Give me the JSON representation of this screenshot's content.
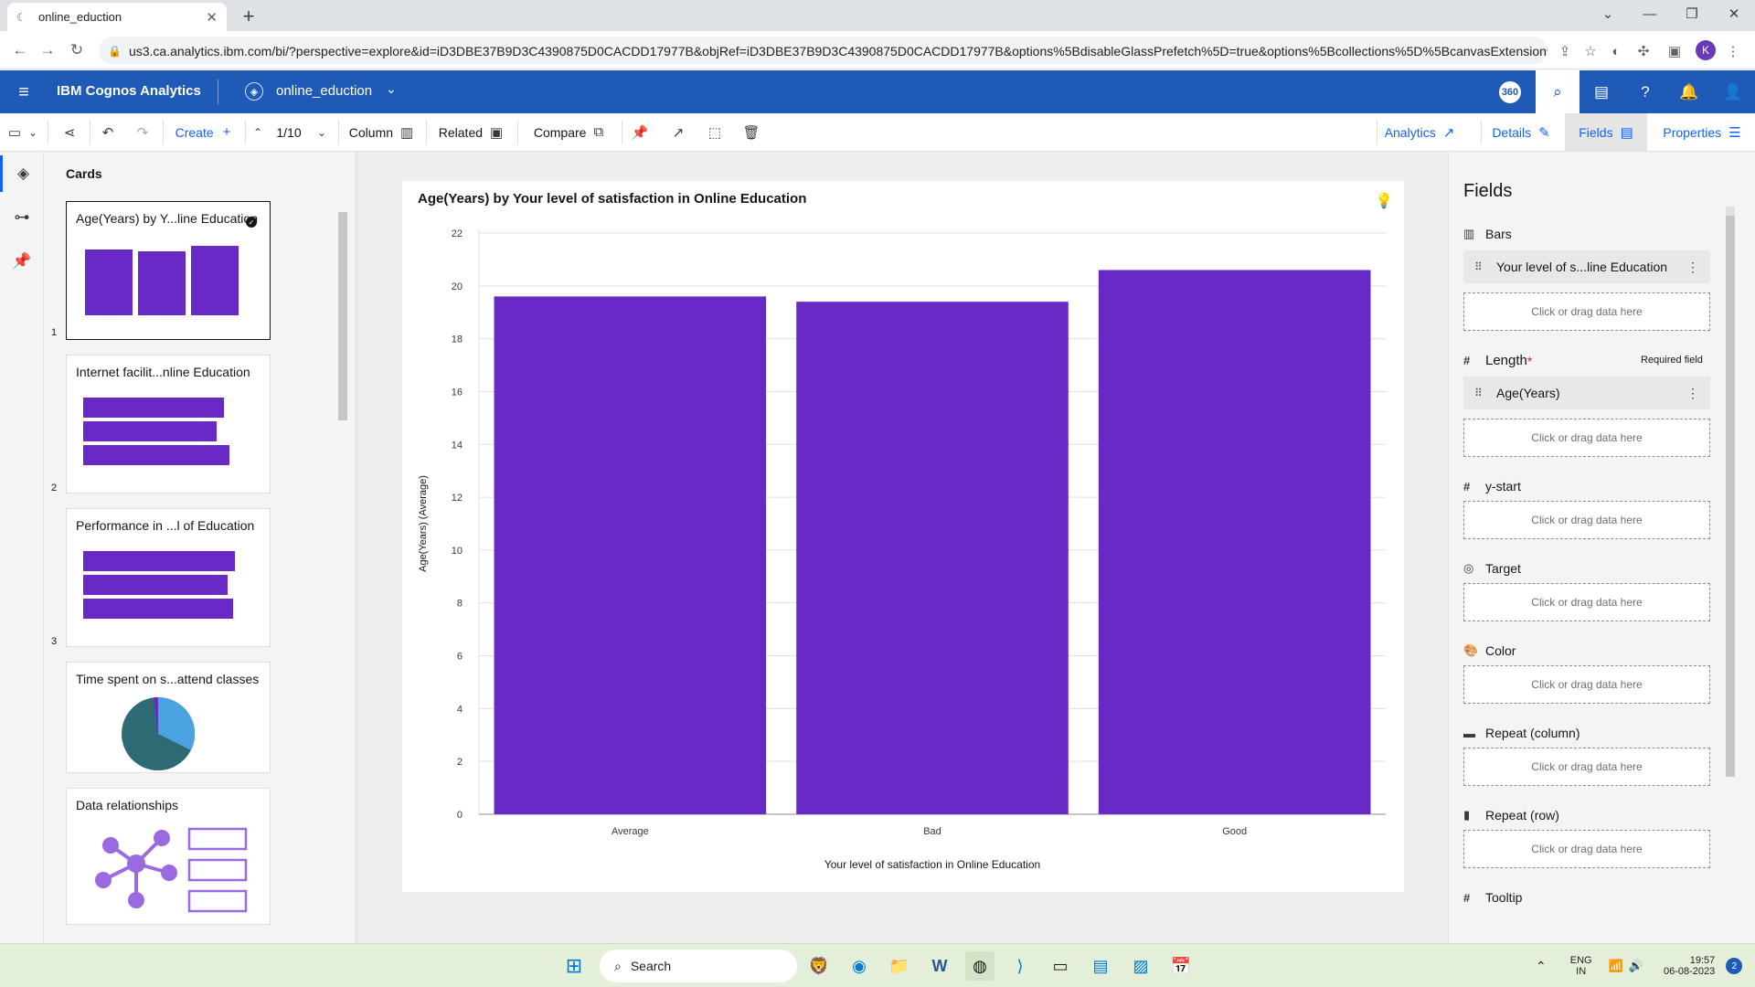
{
  "browser": {
    "tab_title": "online_eduction",
    "url": "us3.ca.analytics.ibm.com/bi/?perspective=explore&id=iD3DBE37B9D3C4390875D0CACDD17977B&objRef=iD3DBE37B9D3C4390875D0CACDD17977B&options%5BdisableGlassPrefetch%5D=true&options%5Bcollections%5D%5BcanvasExtension%5...",
    "profile_initial": "K"
  },
  "header": {
    "brand": "IBM Cognos Analytics",
    "source_name": "online_eduction",
    "badge_360": "360"
  },
  "toolbar": {
    "create_label": "Create",
    "page_indicator": "1/10",
    "column_label": "Column",
    "related_label": "Related",
    "compare_label": "Compare",
    "analytics_label": "Analytics",
    "details_label": "Details",
    "fields_label": "Fields",
    "properties_label": "Properties"
  },
  "cards": {
    "title": "Cards",
    "items": [
      {
        "title": "Age(Years) by Y...line Education",
        "num": "1"
      },
      {
        "title": "Internet facilit...nline Education",
        "num": "2"
      },
      {
        "title": "Performance in ...l of Education",
        "num": "3"
      },
      {
        "title": "Time spent on s...attend classes",
        "num": ""
      },
      {
        "title": "Data relationships",
        "num": ""
      }
    ]
  },
  "chart_data": {
    "type": "bar",
    "title": "Age(Years) by Your level of satisfaction in Online Education",
    "xlabel": "Your level of satisfaction in Online Education",
    "ylabel": "Age(Years) (Average)",
    "categories": [
      "Average",
      "Bad",
      "Good"
    ],
    "values": [
      19.6,
      19.4,
      20.6
    ],
    "ylim": [
      0,
      22
    ],
    "yticks": [
      0,
      2,
      4,
      6,
      8,
      10,
      12,
      14,
      16,
      18,
      20,
      22
    ],
    "color": "#6929c4",
    "grid": true
  },
  "fields": {
    "title": "Fields",
    "drop_text": "Click or drag data here",
    "required_text": "Required field",
    "sections": {
      "bars": "Bars",
      "length": "Length",
      "length_star": "*",
      "ystart": "y-start",
      "target": "Target",
      "color": "Color",
      "repeat_col": "Repeat (column)",
      "repeat_row": "Repeat (row)",
      "tooltip": "Tooltip"
    },
    "bars_value": "Your level of s...line Education",
    "length_value": "Age(Years)"
  },
  "taskbar": {
    "search_placeholder": "Search",
    "lang": "ENG",
    "region": "IN",
    "time": "19:57",
    "date": "06-08-2023",
    "notif_count": "2"
  }
}
